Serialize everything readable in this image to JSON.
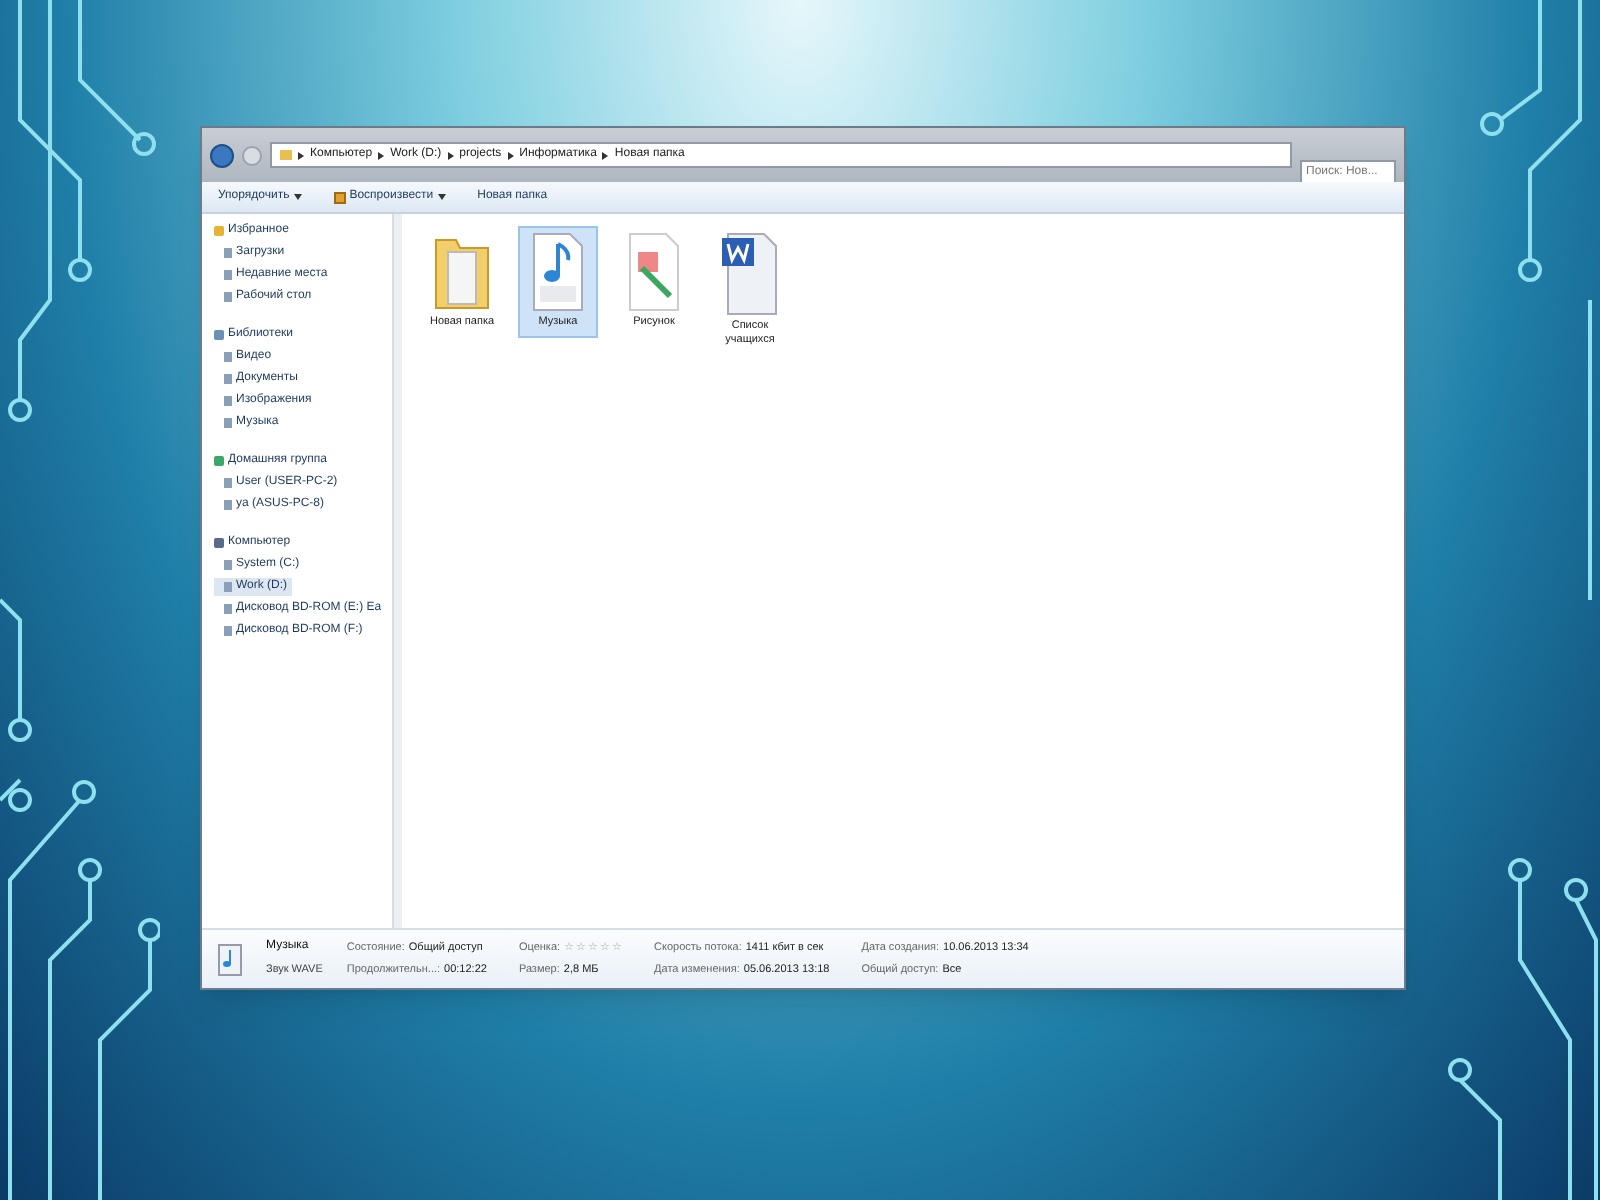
{
  "address_bar": {
    "crumbs": [
      "Компьютер",
      "Work (D:)",
      "projects",
      "Информатика",
      "Новая папка"
    ]
  },
  "search": {
    "placeholder": "Поиск: Нов..."
  },
  "toolbar": {
    "buttons": [
      {
        "label": "Упорядочить",
        "dropdown": true,
        "icon": false
      },
      {
        "label": "Воспроизвести",
        "dropdown": true,
        "icon": true
      },
      {
        "label": "Новая папка",
        "dropdown": false,
        "icon": false
      }
    ]
  },
  "sidebar": {
    "groups": [
      {
        "label": "Избранное",
        "kind": "favorites",
        "children": [
          {
            "label": "Загрузки",
            "selected": false
          },
          {
            "label": "Недавние места",
            "selected": false
          },
          {
            "label": "Рабочий стол",
            "selected": false
          }
        ]
      },
      {
        "label": "Библиотеки",
        "kind": "libraries",
        "children": [
          {
            "label": "Видео",
            "selected": false
          },
          {
            "label": "Документы",
            "selected": false
          },
          {
            "label": "Изображения",
            "selected": false
          },
          {
            "label": "Музыка",
            "selected": false
          }
        ]
      },
      {
        "label": "Домашняя группа",
        "kind": "homegroup",
        "children": [
          {
            "label": "User (USER-PC-2)",
            "selected": false
          },
          {
            "label": "ya (ASUS-PC-8)",
            "selected": false
          }
        ]
      },
      {
        "label": "Компьютер",
        "kind": "computer",
        "children": [
          {
            "label": "System (C:)",
            "selected": false
          },
          {
            "label": "Work (D:)",
            "selected": true
          },
          {
            "label": "Дисковод BD-ROM (E:) Ea",
            "selected": false
          },
          {
            "label": "Дисковод BD-ROM (F:)",
            "selected": false
          }
        ]
      }
    ]
  },
  "files": [
    {
      "name": "Новая папка",
      "kind": "folder",
      "selected": false
    },
    {
      "name": "Музыка",
      "kind": "wav",
      "selected": true
    },
    {
      "name": "Рисунок",
      "kind": "image",
      "selected": false
    },
    {
      "name": "Список учащихся",
      "kind": "word",
      "selected": false
    }
  ],
  "details": {
    "name": "Музыка",
    "type": "Звук WAVE",
    "stars": 0,
    "fields": [
      {
        "label": "Состояние:",
        "kind": "text",
        "value": "Общий доступ"
      },
      {
        "label": "Продолжительн...:",
        "kind": "text",
        "value": "00:12:22"
      },
      {
        "label": "Оценка:",
        "kind": "rating"
      },
      {
        "label": "Размер:",
        "kind": "text",
        "value": "2,8 МБ"
      },
      {
        "label": "Скорость потока:",
        "kind": "text",
        "value": "1411 кбит в сек"
      },
      {
        "label": "Дата изменения:",
        "kind": "text",
        "value": "05.06.2013 13:18"
      },
      {
        "label": "Дата создания:",
        "kind": "text",
        "value": "10.06.2013 13:34"
      },
      {
        "label": "Общий доступ:",
        "kind": "text",
        "value": "Все"
      }
    ]
  }
}
